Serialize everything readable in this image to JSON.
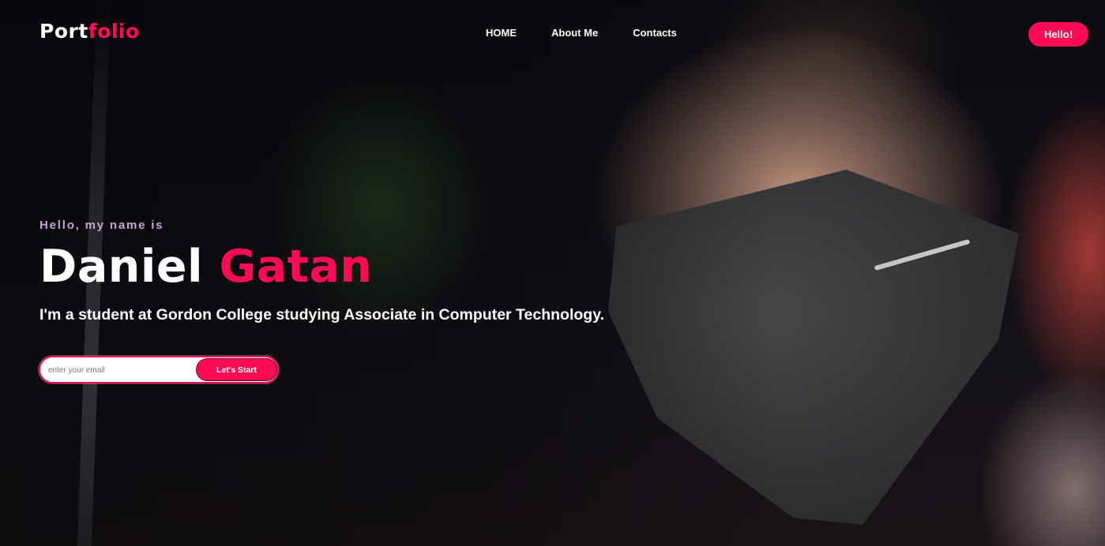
{
  "navbar": {
    "logo_part1": "Port",
    "logo_part2": "folio",
    "links": [
      {
        "label": "HOME"
      },
      {
        "label": "About Me"
      },
      {
        "label": "Contacts"
      }
    ],
    "cta_label": "Hello!"
  },
  "hero": {
    "greeting": "Hello, my name is",
    "first_name": "Daniel",
    "last_name": "Gatan",
    "description": "I'm a student at Gordon College studying Associate in Computer Technology.",
    "email_placeholder": "enter your email",
    "email_value": "",
    "start_button_label": "Let's Start"
  },
  "colors": {
    "accent": "#ff0a54",
    "greeting": "#c8a2d6",
    "text": "#ffffff"
  },
  "background": {
    "image_semantic": "hero-photo-masked-person"
  }
}
